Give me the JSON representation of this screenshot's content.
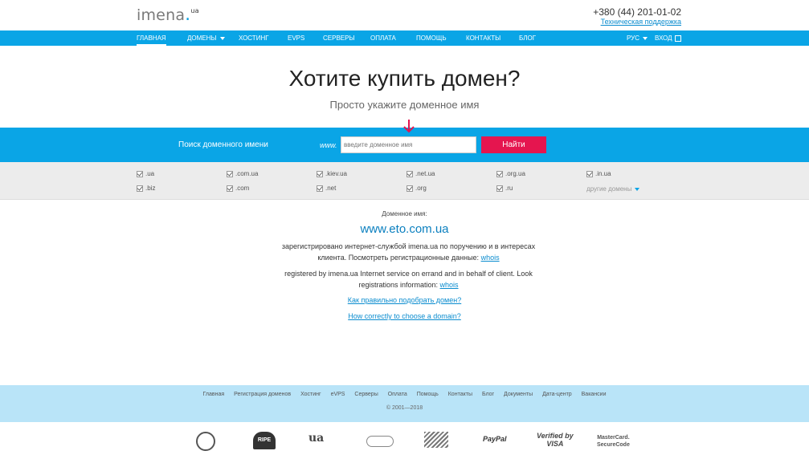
{
  "header": {
    "logo_main": "imena",
    "logo_tld": "ua",
    "phone": "+380 (44) 201-01-02",
    "support_link": "Техническая поддержка"
  },
  "nav": {
    "items": [
      {
        "label": "ГЛАВНАЯ"
      },
      {
        "label": "ДОМЕНЫ"
      },
      {
        "label": "ХОСТИНГ"
      },
      {
        "label": "eVPS"
      },
      {
        "label": "СЕРВЕРЫ"
      },
      {
        "label": "ОПЛАТА"
      },
      {
        "label": "ПОМОЩЬ"
      },
      {
        "label": "КОНТАКТЫ"
      },
      {
        "label": "БЛОГ"
      }
    ],
    "language": "РУС",
    "login": "ВХОД"
  },
  "hero": {
    "title": "Хотите купить домен?",
    "subtitle": "Просто укажите доменное имя"
  },
  "search": {
    "label": "Поиск доменного имени",
    "prefix": "www.",
    "placeholder": "введите доменное имя",
    "button": "Найти"
  },
  "tlds": [
    {
      "label": ".ua"
    },
    {
      "label": ".com.ua"
    },
    {
      "label": ".kiev.ua"
    },
    {
      "label": ".net.ua"
    },
    {
      "label": ".org.ua"
    },
    {
      "label": ".in.ua"
    },
    {
      "label": ".biz"
    },
    {
      "label": ".com"
    },
    {
      "label": ".net"
    },
    {
      "label": ".org"
    },
    {
      "label": ".ru"
    }
  ],
  "other_domains": "другие домены",
  "info": {
    "label": "Доменное имя:",
    "domain": "www.eto.com.ua",
    "ru_text": "зарегистрировано интернет-службой imena.ua по поручению и в интересах клиента. Посмотреть регистрационные данные:",
    "ru_link": "whois",
    "en_text": "registered by imena.ua Internet service on errand and in behalf of client. Look registrations information:",
    "en_link": "whois",
    "link_ru": "Как правильно подобрать домен?",
    "link_en": "How correctly to choose a domain?"
  },
  "footer": {
    "links": [
      "Главная",
      "Регистрация доменов",
      "Хостинг",
      "eVPS",
      "Серверы",
      "Оплата",
      "Помощь",
      "Контакты",
      "Блог",
      "Документы",
      "Дата-центр",
      "Вакансии"
    ],
    "copyright": "© 2001—2018"
  },
  "partners": {
    "ripe": "RIPE",
    "ua": "ua",
    "paypal": "PayPal",
    "visa_top": "Verified by",
    "visa_bottom": "VISA",
    "mc_top": "MasterCard.",
    "mc_bottom": "SecureCode"
  }
}
